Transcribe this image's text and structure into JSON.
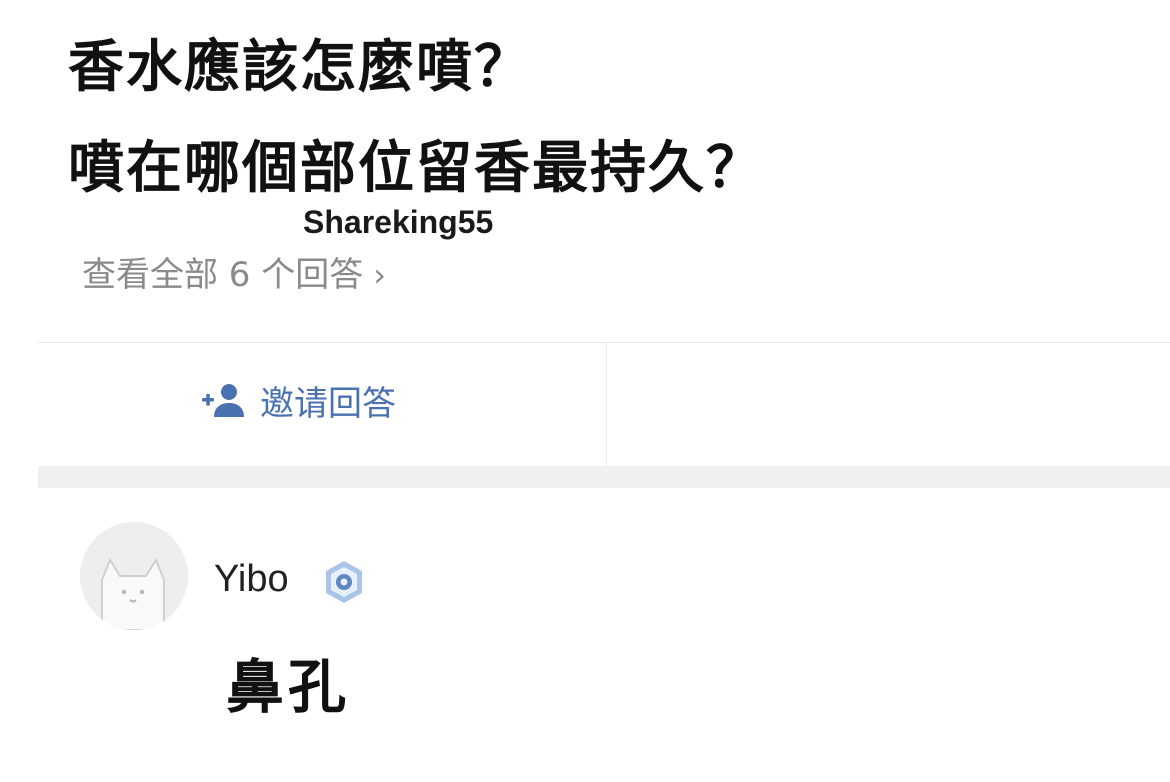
{
  "question": {
    "title_line1": "香水應該怎麼噴？",
    "title_line2": "噴在哪個部位留香最持久？"
  },
  "watermark": "Shareking55",
  "answers_link": {
    "label": "查看全部 6 个回答",
    "chevron": "›",
    "icon": "chevron-right-icon"
  },
  "actions": {
    "invite_label": "邀请回答",
    "invite_icon": "add-user-icon"
  },
  "answer": {
    "username": "Yibo",
    "badge_icon": "verified-badge-icon",
    "avatar_icon": "cat-avatar-icon",
    "text": "鼻孔"
  },
  "colors": {
    "title": "#111111",
    "muted": "#8a8a8a",
    "link_blue": "#4b72b0",
    "band_gray": "#eef0f2"
  }
}
